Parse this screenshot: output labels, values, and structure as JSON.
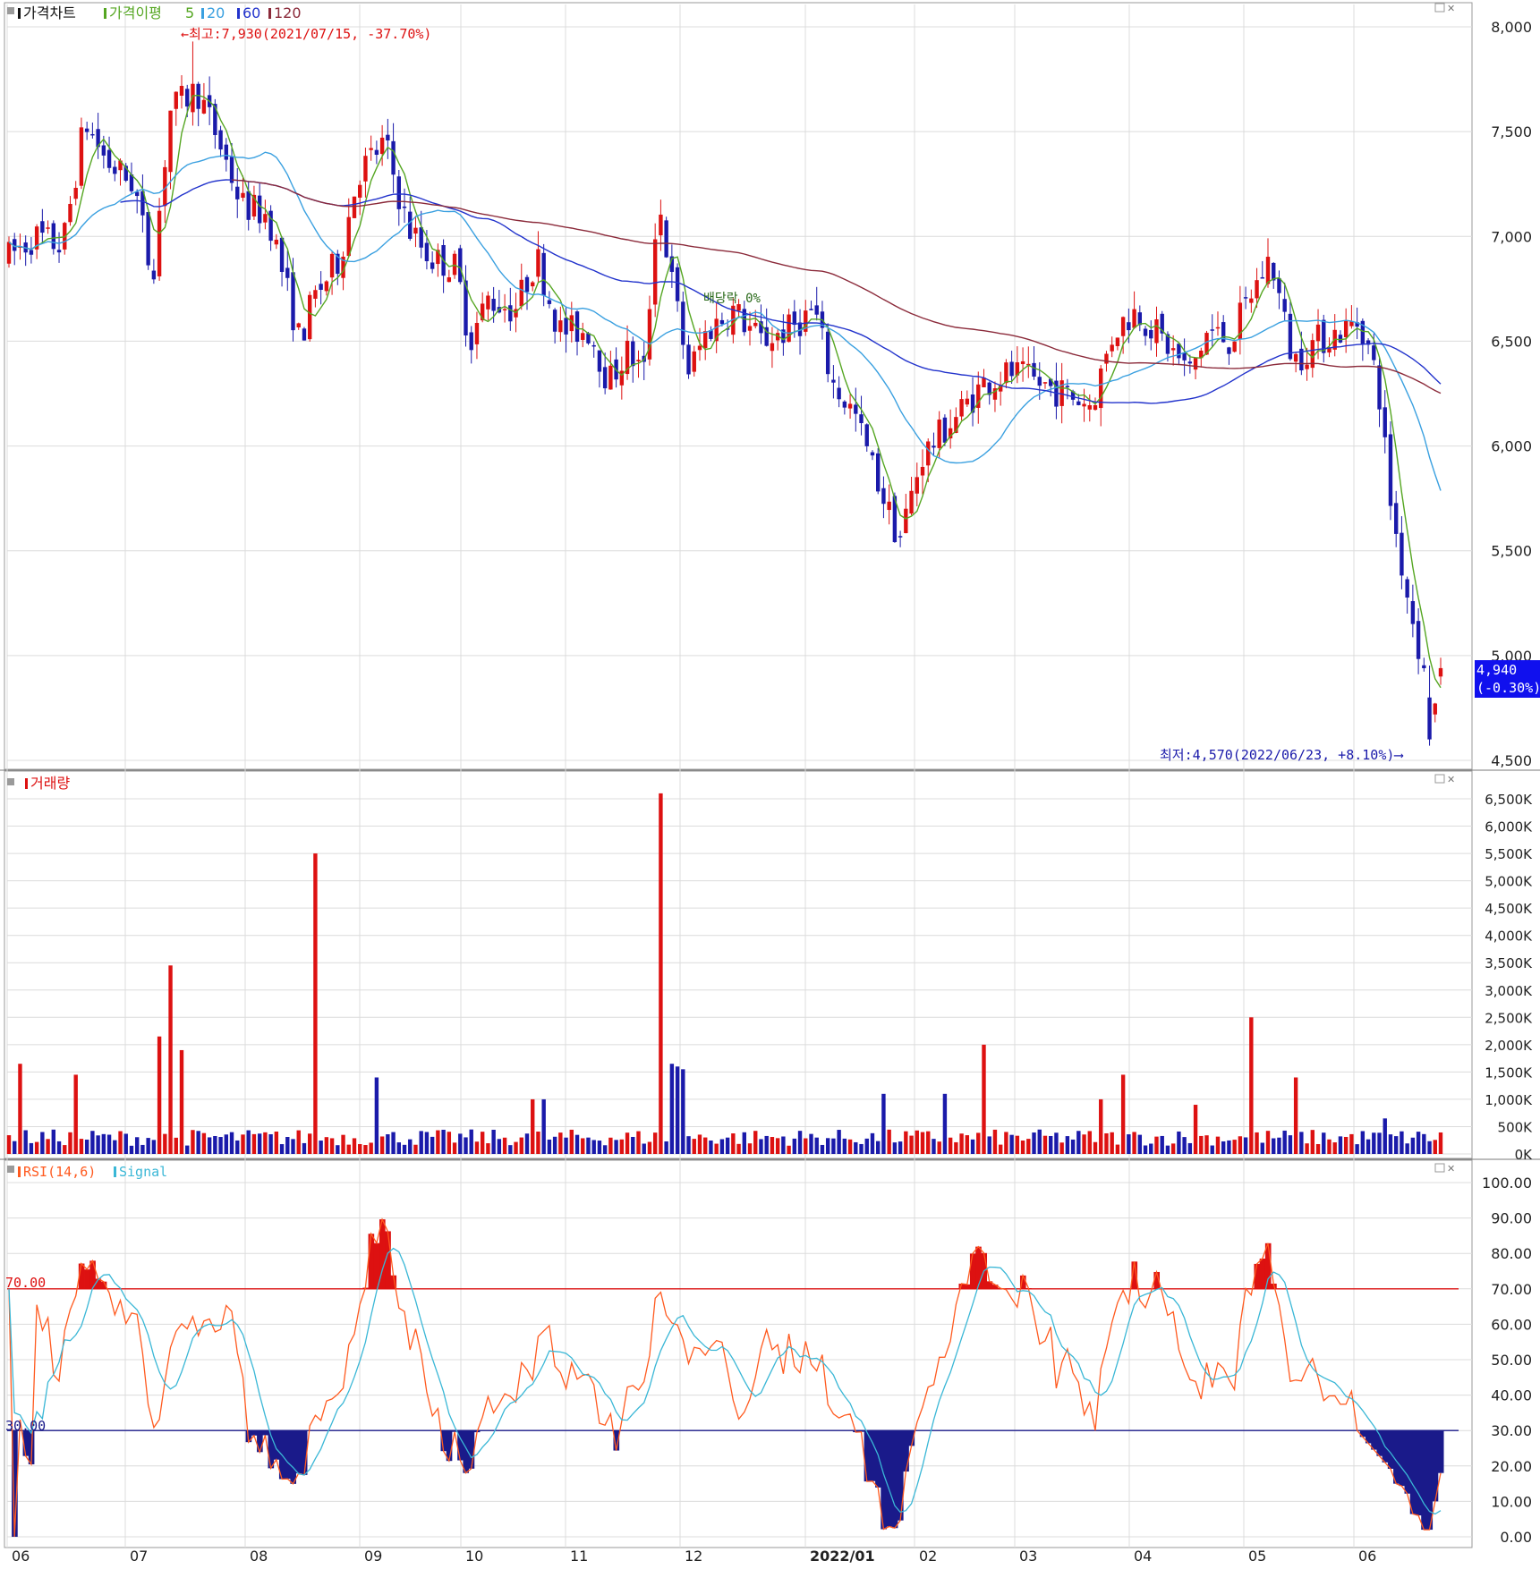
{
  "colors": {
    "up": "#dd1111",
    "down": "#1a1aaa",
    "ma5": "#55a622",
    "ma20": "#3aa0e0",
    "ma60": "#2233cc",
    "ma120": "#8b2a3a",
    "rsi": "#ff5a1f",
    "signal": "#3ab7d6",
    "overbought": "#dd1111",
    "oversold": "#1a1a8a",
    "grid": "#dcdcdc",
    "frame": "#9a9a9a",
    "price_tag": "#1010ee"
  },
  "price_panel": {
    "legend": {
      "title": "가격차트",
      "ma_label": "가격이평",
      "periods": [
        "5",
        "20",
        "60",
        "120"
      ]
    },
    "y_ticks": [
      "8,000",
      "7,500",
      "7,000",
      "6,500",
      "6,000",
      "5,500",
      "5,000",
      "4,500"
    ],
    "high_annotation": "←최고:7,930(2021/07/15, -37.70%)",
    "low_annotation": "최저:4,570(2022/06/23, +8.10%)⟶",
    "dividend_annotation": "배당락 0%",
    "last_price": "4,940",
    "last_change": "(-0.30%)"
  },
  "volume_panel": {
    "legend": "거래량",
    "y_ticks": [
      "6,500K",
      "6,000K",
      "5,500K",
      "5,000K",
      "4,500K",
      "4,000K",
      "3,500K",
      "3,000K",
      "2,500K",
      "2,000K",
      "1,500K",
      "1,000K",
      "500K",
      "0K"
    ]
  },
  "rsi_panel": {
    "legend_rsi": "RSI(14,6)",
    "legend_signal": "Signal",
    "y_ticks": [
      "100.00",
      "90.00",
      "80.00",
      "70.00",
      "60.00",
      "50.00",
      "40.00",
      "30.00",
      "20.00",
      "10.00",
      "0.00"
    ],
    "upper_line_label": "70.00",
    "lower_line_label": "30.00"
  },
  "x_axis": {
    "labels": [
      "06",
      "07",
      "08",
      "09",
      "10",
      "11",
      "12",
      "2022/01",
      "02",
      "03",
      "04",
      "05",
      "06"
    ]
  },
  "chart_data": [
    {
      "type": "candlestick",
      "title": "가격차트",
      "ylim": [
        4500,
        8000
      ],
      "x_months": [
        "06",
        "07",
        "08",
        "09",
        "10",
        "11",
        "12",
        "2022/01",
        "02",
        "03",
        "04",
        "05",
        "06"
      ],
      "close_points": [
        {
          "month": "06",
          "value": 6950
        },
        {
          "month": "07",
          "value": 7500
        },
        {
          "month": "08",
          "value": 7200
        },
        {
          "month": "09",
          "value": 7150
        },
        {
          "month": "10",
          "value": 6450
        },
        {
          "month": "11",
          "value": 6700
        },
        {
          "month": "12",
          "value": 6550
        },
        {
          "month": "2022/01",
          "value": 6350
        },
        {
          "month": "02",
          "value": 5900
        },
        {
          "month": "03",
          "value": 6150
        },
        {
          "month": "04",
          "value": 6500
        },
        {
          "month": "05",
          "value": 6550
        },
        {
          "month": "06",
          "value": 6600
        }
      ],
      "high": {
        "value": 7930,
        "date": "2021/07/15"
      },
      "low": {
        "value": 4570,
        "date": "2022/06/23"
      },
      "last": 4940,
      "moving_averages": [
        5,
        20,
        60,
        120
      ]
    },
    {
      "type": "bar",
      "title": "거래량",
      "unit": "K",
      "ylim": [
        0,
        6500
      ],
      "notable_spikes_K": [
        {
          "month": "07",
          "value": 3450
        },
        {
          "month": "08",
          "value": 5500
        },
        {
          "month": "11",
          "value": 6600
        },
        {
          "month": "2022/01",
          "value": 2000
        },
        {
          "month": "05",
          "value": 2500
        }
      ]
    },
    {
      "type": "line",
      "title": "RSI(14,6)",
      "series": [
        {
          "name": "RSI(14,6)"
        },
        {
          "name": "Signal"
        }
      ],
      "ylim": [
        0,
        100
      ],
      "reference_lines": [
        70,
        30
      ],
      "minimum": 2
    }
  ]
}
